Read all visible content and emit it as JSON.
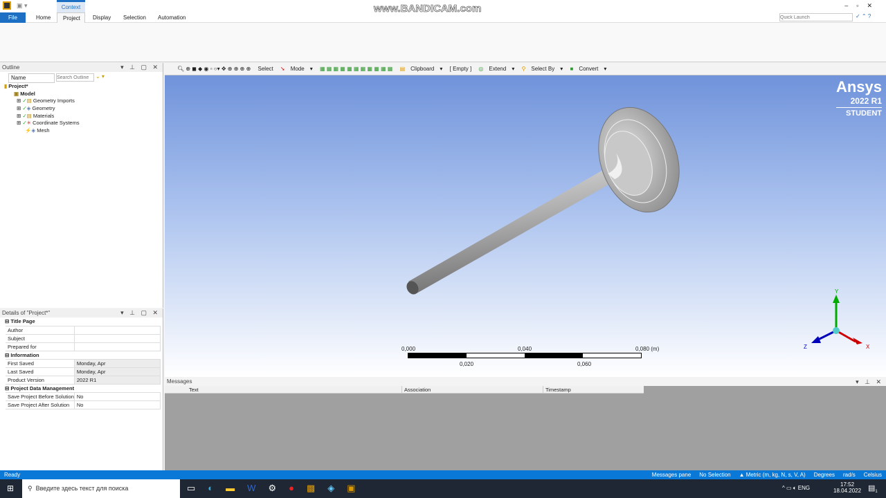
{
  "ribbon": {
    "context": "Context",
    "tabs": [
      "File",
      "Home",
      "Project",
      "Display",
      "Selection",
      "Automation"
    ],
    "quick_launch_placeholder": "Quick Launch",
    "watermark": "www.BANDICAM.com"
  },
  "outline": {
    "title": "Outline",
    "name_filter": "Name",
    "search_placeholder": "Search Outline",
    "tree": [
      "Project*",
      "Model",
      "Geometry Imports",
      "Geometry",
      "Materials",
      "Coordinate Systems",
      "Mesh"
    ]
  },
  "details": {
    "title": "Details of \"Project*\"",
    "groups": [
      {
        "name": "Title Page",
        "rows": [
          [
            "Author",
            ""
          ],
          [
            "Subject",
            ""
          ],
          [
            "Prepared for",
            ""
          ]
        ]
      },
      {
        "name": "Information",
        "rows": [
          [
            "First Saved",
            "Monday, Apr"
          ],
          [
            "Last Saved",
            "Monday, Apr"
          ],
          [
            "Product Version",
            "2022 R1"
          ]
        ]
      },
      {
        "name": "Project Data Management",
        "rows": [
          [
            "Save Project Before Solution",
            "No"
          ],
          [
            "Save Project After Solution",
            "No"
          ]
        ]
      }
    ]
  },
  "toolbar": {
    "select": "Select",
    "mode": "Mode",
    "clipboard": "Clipboard",
    "empty": "[ Empty ]",
    "extend": "Extend",
    "select_by": "Select By",
    "convert": "Convert"
  },
  "viewport": {
    "brand": "Ansys",
    "version": "2022 R1",
    "edition": "STUDENT",
    "scale_top": [
      "0,000",
      "0,040",
      "0,080 (m)"
    ],
    "scale_bottom": [
      "0,020",
      "0,060"
    ],
    "axes": [
      "X",
      "Y",
      "Z"
    ]
  },
  "messages": {
    "title": "Messages",
    "columns": [
      "Text",
      "Association",
      "Timestamp"
    ]
  },
  "status": {
    "left": "Ready",
    "items": [
      "Messages pane",
      "No Selection",
      "▲ Metric (m, kg, N, s, V, A)",
      "Degrees",
      "rad/s",
      "Celsius"
    ]
  },
  "taskbar": {
    "search_placeholder": "Введите здесь текст для поиска",
    "lang": "ENG",
    "time": "17:52",
    "date": "18.04.2022",
    "notif_count": "1"
  },
  "colors": {
    "accent": "#0a78d6",
    "viewport_top": "#6a8ed8"
  }
}
